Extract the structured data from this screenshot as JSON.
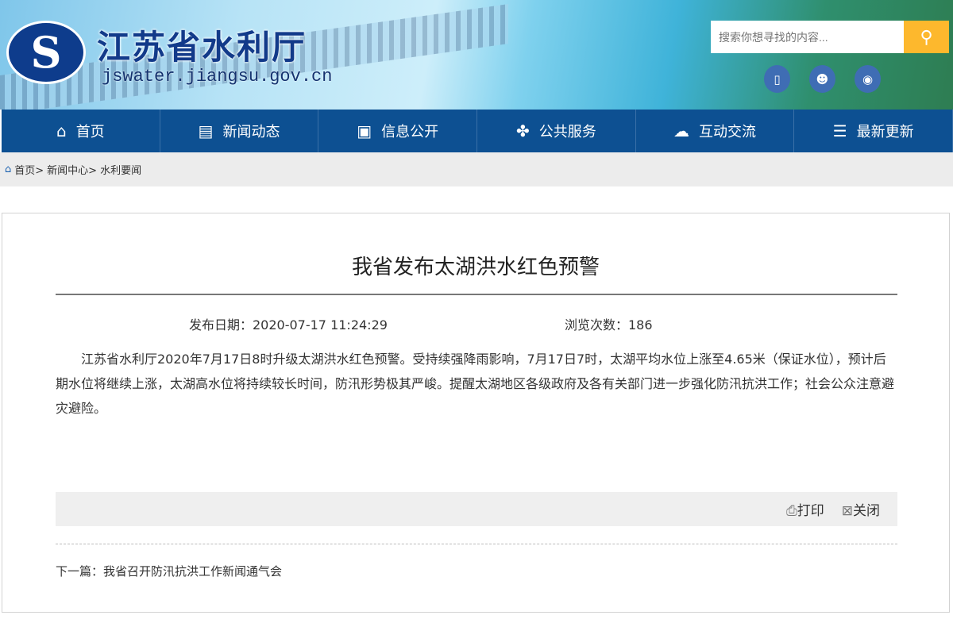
{
  "header": {
    "site_name": "江苏省水利厅",
    "site_url": "jswater.jiangsu.gov.cn",
    "search_placeholder": "搜索你想寻找的内容..."
  },
  "nav": [
    {
      "label": "首页",
      "icon": "⌂"
    },
    {
      "label": "新闻动态",
      "icon": "▤"
    },
    {
      "label": "信息公开",
      "icon": "▣"
    },
    {
      "label": "公共服务",
      "icon": "✤"
    },
    {
      "label": "互动交流",
      "icon": "☁"
    },
    {
      "label": "最新更新",
      "icon": "☰"
    }
  ],
  "breadcrumb": [
    "首页>",
    "新闻中心>",
    "水利要闻"
  ],
  "article": {
    "title": "我省发布太湖洪水红色预警",
    "date": "发布日期：2020-07-17 11:24:29",
    "views": "浏览次数：186",
    "body": "江苏省水利厅2020年7月17日8时升级太湖洪水红色预警。受持续强降雨影响，7月17日7时，太湖平均水位上涨至4.65米（保证水位），预计后期水位将继续上涨，太湖高水位将持续较长时间，防汛形势极其严峻。提醒太湖地区各级政府及各有关部门进一步强化防汛抗洪工作；社会公众注意避灾避险。",
    "print": "打印",
    "close": "关闭",
    "next": "下一篇：我省召开防汛抗洪工作新闻通气会"
  }
}
